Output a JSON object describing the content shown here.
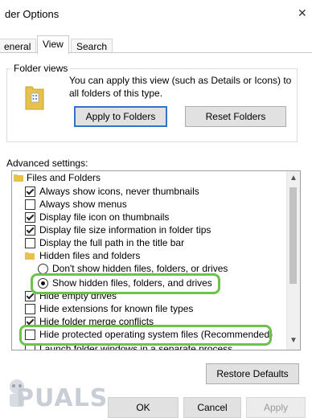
{
  "window": {
    "title": "der Options",
    "close_glyph": "✕"
  },
  "tabs": [
    {
      "label": "eneral"
    },
    {
      "label": "View"
    },
    {
      "label": "Search"
    }
  ],
  "folder_views": {
    "title": "Folder views",
    "description": "You can apply this view (such as Details or Icons) to all folders of this type.",
    "apply_label": "Apply to Folders",
    "reset_label": "Reset Folders"
  },
  "advanced": {
    "label": "Advanced settings:",
    "items": [
      {
        "text": "Files and Folders",
        "kind": "folder"
      },
      {
        "text": "Always show icons, never thumbnails",
        "kind": "checkbox",
        "checked": true
      },
      {
        "text": "Always show menus",
        "kind": "checkbox",
        "checked": false
      },
      {
        "text": "Display file icon on thumbnails",
        "kind": "checkbox",
        "checked": true
      },
      {
        "text": "Display file size information in folder tips",
        "kind": "checkbox",
        "checked": true
      },
      {
        "text": "Display the full path in the title bar",
        "kind": "checkbox",
        "checked": false
      },
      {
        "text": "Hidden files and folders",
        "kind": "folder"
      },
      {
        "text": "Don't show hidden files, folders, or drives",
        "kind": "radio",
        "checked": false
      },
      {
        "text": "Show hidden files, folders, and drives",
        "kind": "radio",
        "checked": true
      },
      {
        "text": "Hide empty drives",
        "kind": "checkbox",
        "checked": true
      },
      {
        "text": "Hide extensions for known file types",
        "kind": "checkbox",
        "checked": false
      },
      {
        "text": "Hide folder merge conflicts",
        "kind": "checkbox",
        "checked": true
      },
      {
        "text": "Hide protected operating system files (Recommended)",
        "kind": "checkbox",
        "checked": false
      },
      {
        "text": "Launch folder windows in a separate process",
        "kind": "checkbox",
        "checked": false
      }
    ]
  },
  "restore_label": "Restore Defaults",
  "footer": {
    "ok": "OK",
    "cancel": "Cancel",
    "apply": "Apply"
  },
  "watermark": "PUALS"
}
